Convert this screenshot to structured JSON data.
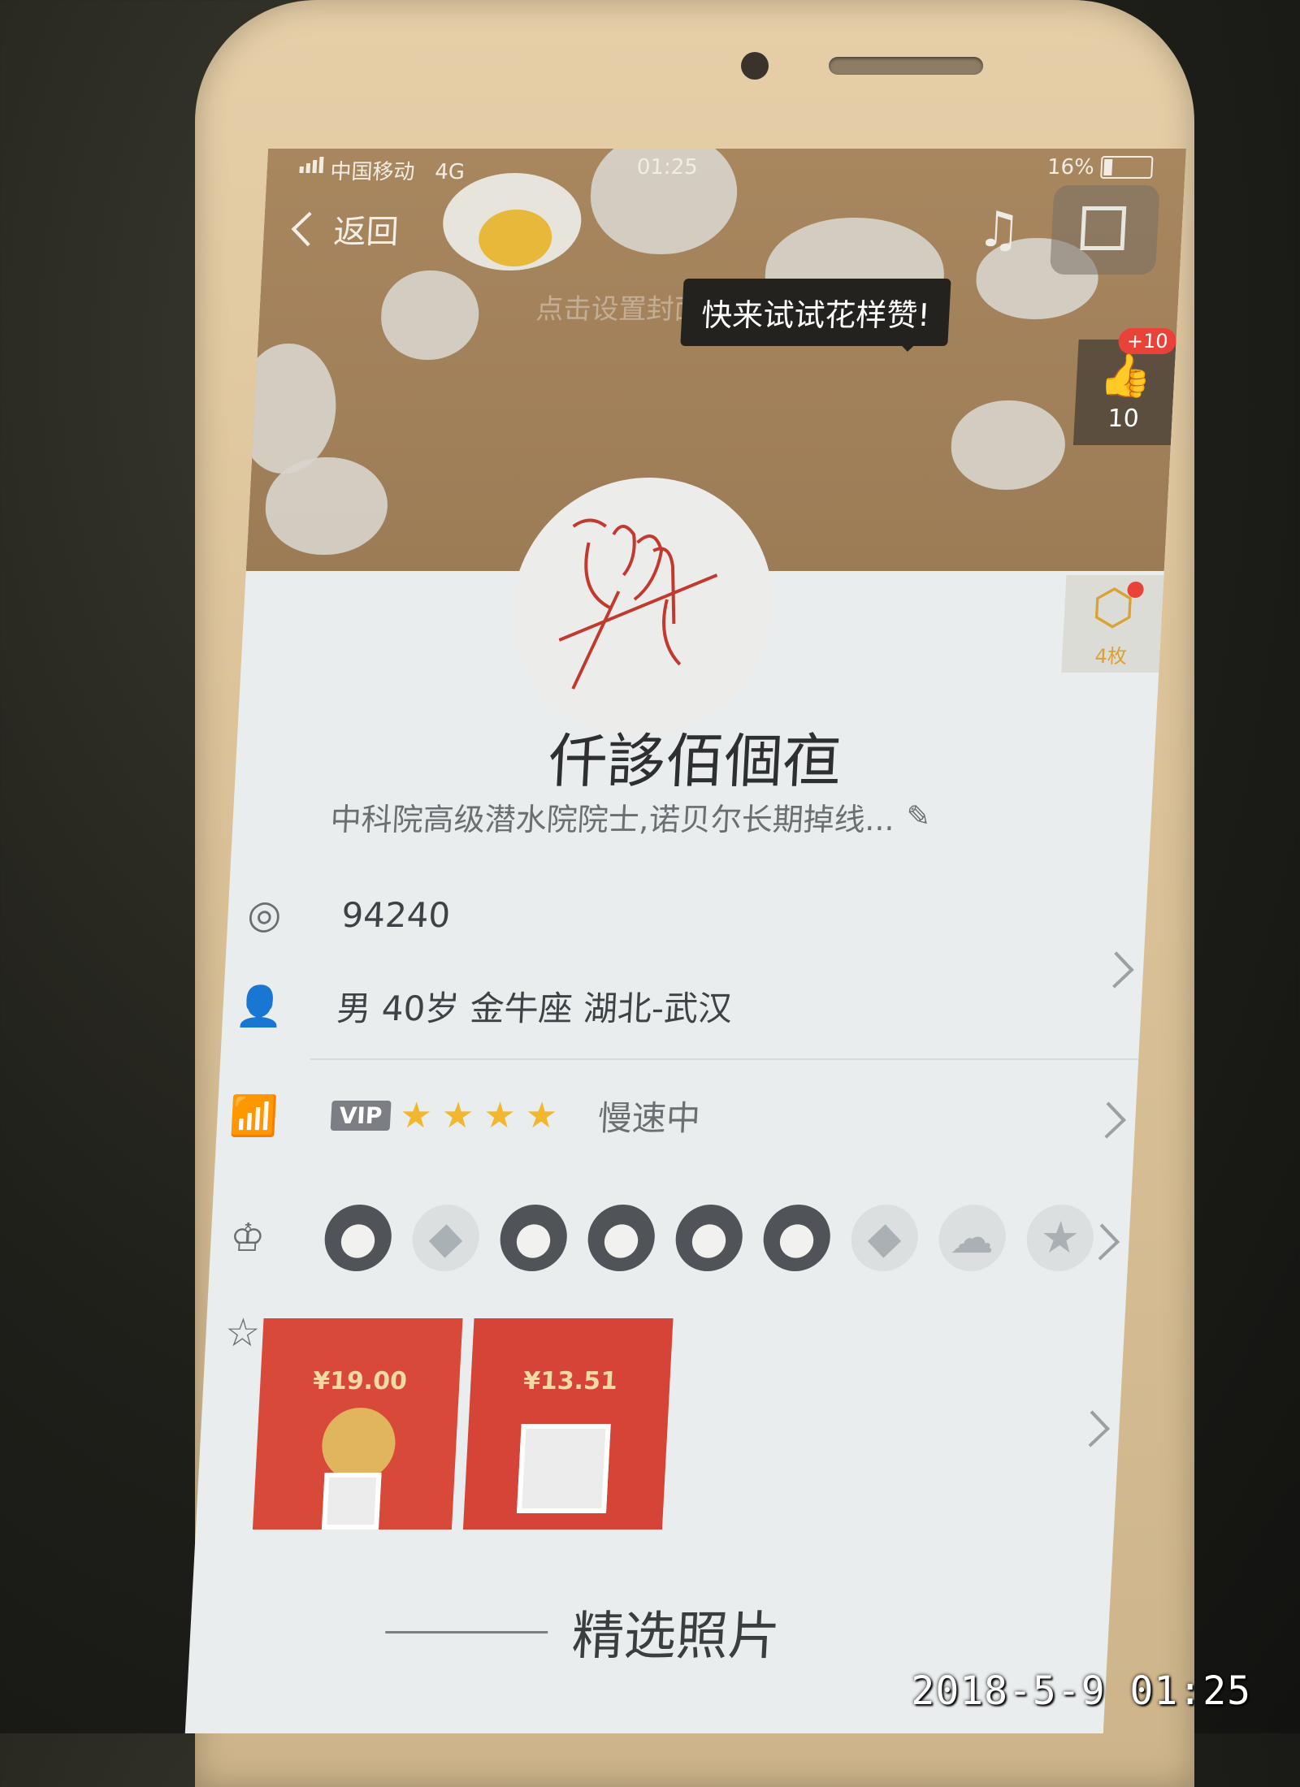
{
  "status_bar": {
    "carrier": "中国移动",
    "network": "4G",
    "time": "01:25",
    "battery": "16%"
  },
  "nav": {
    "back_label": "返回",
    "set_cover_hint": "点击设置封面"
  },
  "tooltip": "快来试试花样赞!",
  "like": {
    "plus": "+10",
    "count": "10"
  },
  "medal": {
    "label": "4枚"
  },
  "profile": {
    "name": "仟誃佰個亱",
    "signature": "中科院高级潜水院院士,诺贝尔长期掉线...",
    "qq": "94240",
    "info": "男 40岁 金牛座 湖北-武汉",
    "vip_label": "VIP",
    "level_stars": 4,
    "speed_text": "慢速中"
  },
  "cards": [
    {
      "amount": "¥19.00"
    },
    {
      "amount": "¥13.51"
    }
  ],
  "section_title": "精选照片",
  "photo_timestamp": "2018-5-9 01:25",
  "colors": {
    "accent_red": "#e94238",
    "star_gold": "#f2b730",
    "header_brown": "#a8875f"
  },
  "icons": {
    "qq": "qq-penguin-icon",
    "person": "person-icon",
    "level": "level-chart-icon",
    "badge": "crown-badge-icon",
    "favorite": "star-outline-icon"
  }
}
